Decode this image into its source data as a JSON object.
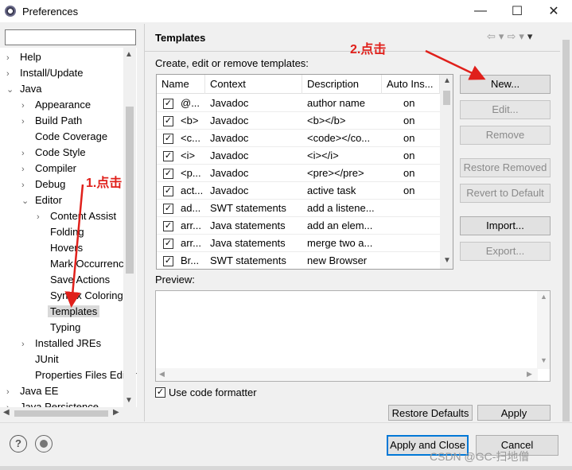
{
  "window": {
    "title": "Preferences",
    "min_glyph": "—",
    "max_glyph": "☐",
    "close_glyph": "✕"
  },
  "filter": {
    "value": "",
    "placeholder": ""
  },
  "tree": [
    {
      "label": "Help",
      "arrow": "›",
      "indent": 0
    },
    {
      "label": "Install/Update",
      "arrow": "›",
      "indent": 0
    },
    {
      "label": "Java",
      "arrow": "⌄",
      "indent": 0
    },
    {
      "label": "Appearance",
      "arrow": "›",
      "indent": 1
    },
    {
      "label": "Build Path",
      "arrow": "›",
      "indent": 1
    },
    {
      "label": "Code Coverage",
      "arrow": "",
      "indent": 1
    },
    {
      "label": "Code Style",
      "arrow": "›",
      "indent": 1
    },
    {
      "label": "Compiler",
      "arrow": "›",
      "indent": 1
    },
    {
      "label": "Debug",
      "arrow": "›",
      "indent": 1
    },
    {
      "label": "Editor",
      "arrow": "⌄",
      "indent": 1
    },
    {
      "label": "Content Assist",
      "arrow": "›",
      "indent": 2
    },
    {
      "label": "Folding",
      "arrow": "",
      "indent": 2
    },
    {
      "label": "Hovers",
      "arrow": "",
      "indent": 2
    },
    {
      "label": "Mark Occurrences",
      "arrow": "",
      "indent": 2
    },
    {
      "label": "Save Actions",
      "arrow": "",
      "indent": 2
    },
    {
      "label": "Syntax Coloring",
      "arrow": "",
      "indent": 2
    },
    {
      "label": "Templates",
      "arrow": "",
      "indent": 2,
      "selected": true
    },
    {
      "label": "Typing",
      "arrow": "",
      "indent": 2
    },
    {
      "label": "Installed JREs",
      "arrow": "›",
      "indent": 1
    },
    {
      "label": "JUnit",
      "arrow": "",
      "indent": 1
    },
    {
      "label": "Properties Files Editor",
      "arrow": "",
      "indent": 1
    },
    {
      "label": "Java EE",
      "arrow": "›",
      "indent": 0
    },
    {
      "label": "Java Persistence",
      "arrow": "›",
      "indent": 0
    }
  ],
  "page": {
    "title": "Templates",
    "nav_back": "⇦",
    "nav_fwd": "⇨",
    "menu": "▾",
    "description": "Create, edit or remove templates:"
  },
  "table": {
    "columns": [
      "Name",
      "Context",
      "Description",
      "Auto Ins..."
    ],
    "rows": [
      {
        "checked": true,
        "name": "@...",
        "context": "Javadoc",
        "description": "author name",
        "auto": "on"
      },
      {
        "checked": true,
        "name": "<b>",
        "context": "Javadoc",
        "description": "<b></b>",
        "auto": "on"
      },
      {
        "checked": true,
        "name": "<c...",
        "context": "Javadoc",
        "description": "<code></co...",
        "auto": "on"
      },
      {
        "checked": true,
        "name": "<i>",
        "context": "Javadoc",
        "description": "<i></i>",
        "auto": "on"
      },
      {
        "checked": true,
        "name": "<p...",
        "context": "Javadoc",
        "description": "<pre></pre>",
        "auto": "on"
      },
      {
        "checked": true,
        "name": "act...",
        "context": "Javadoc",
        "description": "active task",
        "auto": "on"
      },
      {
        "checked": true,
        "name": "ad...",
        "context": "SWT statements",
        "description": "add a listene...",
        "auto": ""
      },
      {
        "checked": true,
        "name": "arr...",
        "context": "Java statements",
        "description": "add an elem...",
        "auto": ""
      },
      {
        "checked": true,
        "name": "arr...",
        "context": "Java statements",
        "description": "merge two a...",
        "auto": ""
      },
      {
        "checked": true,
        "name": "Br...",
        "context": "SWT statements",
        "description": "new Browser",
        "auto": ""
      }
    ]
  },
  "buttons": {
    "new": "New...",
    "edit": "Edit...",
    "remove": "Remove",
    "restore_removed": "Restore Removed",
    "revert_default": "Revert to Default",
    "import": "Import...",
    "export": "Export..."
  },
  "preview": {
    "label": "Preview:"
  },
  "formatter": {
    "label": "Use code formatter",
    "checked": true
  },
  "bottom_buttons": {
    "restore_defaults": "Restore Defaults",
    "apply": "Apply"
  },
  "footer": {
    "help": "?",
    "apply_close": "Apply and Close",
    "cancel": "Cancel"
  },
  "annotations": {
    "step1": "1.点击",
    "step2": "2.点击",
    "color": "#e0201b"
  },
  "watermark": "CSDN @GC-扫地僧"
}
